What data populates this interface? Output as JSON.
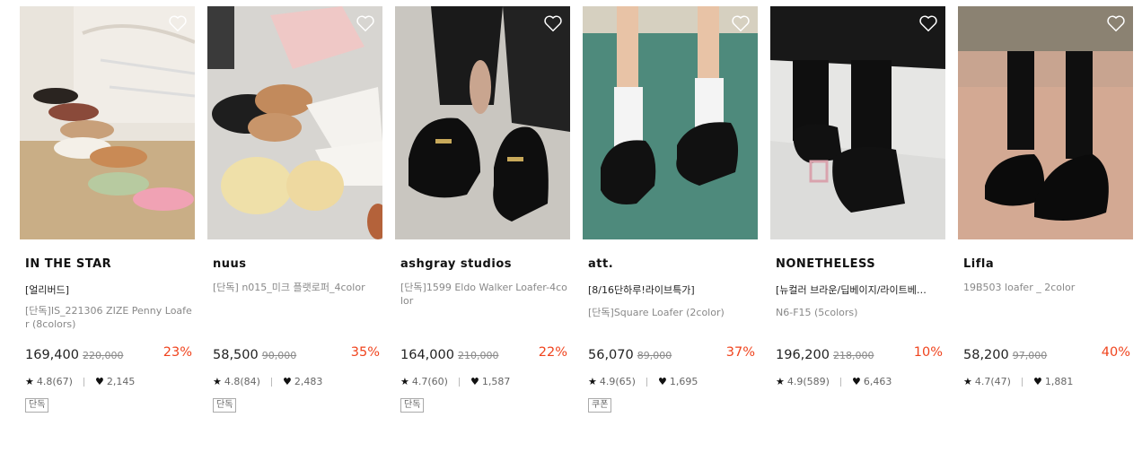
{
  "products": [
    {
      "brand": "IN THE STAR",
      "tag": "[얼리버드]",
      "name": "[단독]IS_221306 ZIZE Penny Loafer (8colors)",
      "price": "169,400",
      "original_price": "220,000",
      "discount": "23%",
      "rating": "4.8(67)",
      "likes": "2,145",
      "badge": "단독"
    },
    {
      "brand": "nuus",
      "tag": "",
      "name": "[단독] n015_미크 플랫로퍼_4color",
      "price": "58,500",
      "original_price": "90,000",
      "discount": "35%",
      "rating": "4.8(84)",
      "likes": "2,483",
      "badge": "단독"
    },
    {
      "brand": "ashgray studios",
      "tag": "",
      "name": "[단독]1599 Eldo Walker Loafer-4color",
      "price": "164,000",
      "original_price": "210,000",
      "discount": "22%",
      "rating": "4.7(60)",
      "likes": "1,587",
      "badge": "단독"
    },
    {
      "brand": "att.",
      "tag": "[8/16단하루!라이브특가]",
      "name": "[단독]Square Loafer (2color)",
      "price": "56,070",
      "original_price": "89,000",
      "discount": "37%",
      "rating": "4.9(65)",
      "likes": "1,695",
      "badge": "쿠폰"
    },
    {
      "brand": "NONETHELESS",
      "tag": "[뉴컬러 브라운/딥베이지/라이트베…",
      "name": "N6-F15 (5colors)",
      "price": "196,200",
      "original_price": "218,000",
      "discount": "10%",
      "rating": "4.9(589)",
      "likes": "6,463",
      "badge": ""
    },
    {
      "brand": "Lifla",
      "tag": "",
      "name": "19B503 loafer _ 2color",
      "price": "58,200",
      "original_price": "97,000",
      "discount": "40%",
      "rating": "4.7(47)",
      "likes": "1,881",
      "badge": ""
    }
  ],
  "icons": {
    "wishlist": "heart-outline-icon",
    "rating": "star-icon",
    "likes": "heart-filled-icon"
  },
  "colors": {
    "discount": "#f0441e",
    "muted": "#888888"
  }
}
